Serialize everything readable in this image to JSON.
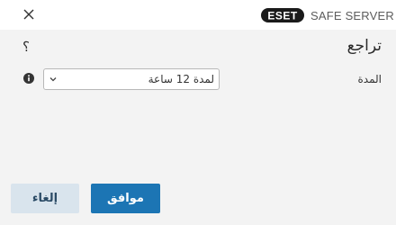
{
  "header": {
    "close_icon": "close-icon",
    "brand_logo": "ESET",
    "product_name": "SAFE SERVER"
  },
  "dialog": {
    "title": "تراجع",
    "help_icon": "help-icon",
    "help_symbol": "؟"
  },
  "duration": {
    "label": "المدة",
    "info_icon": "info-icon",
    "selected_value": "لمدة 12 ساعة",
    "chevron_icon": "chevron-down-icon"
  },
  "buttons": {
    "ok_label": "موافق",
    "cancel_label": "إلغاء"
  },
  "colors": {
    "primary_button": "#1c75b4",
    "secondary_button": "#d9e4ed",
    "content_background": "#f3f3f3"
  }
}
